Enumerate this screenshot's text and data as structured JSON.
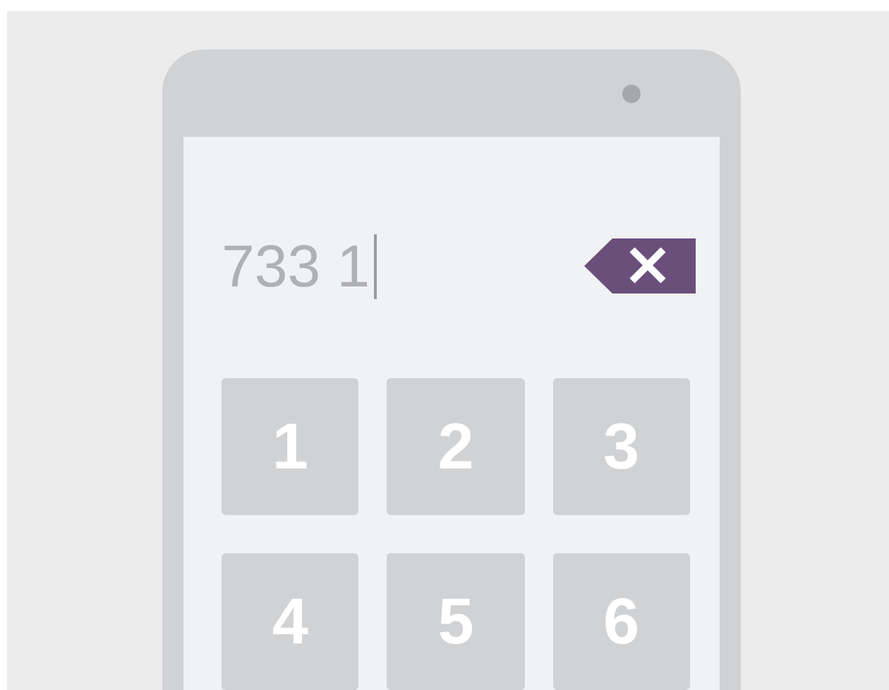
{
  "display": {
    "value": "733 1"
  },
  "keys": [
    "1",
    "2",
    "3",
    "4",
    "5",
    "6"
  ]
}
